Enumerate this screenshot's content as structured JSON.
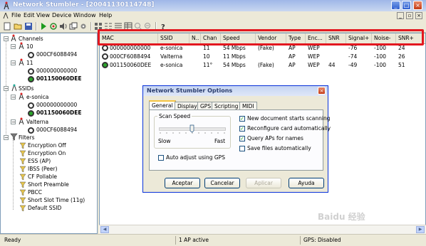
{
  "window": {
    "title": "Network Stumbler - [20041130114748]"
  },
  "menu": [
    "File",
    "Edit",
    "View",
    "Device",
    "Window",
    "Help"
  ],
  "tree": {
    "channels_label": "Channels",
    "ch10_label": "10",
    "ch10_mac": "000CF6088494",
    "ch11_label": "11",
    "ch11_mac1": "000000000000",
    "ch11_mac2": "001150060DEE",
    "ssids_label": "SSIDs",
    "ssid1_label": "e-sonica",
    "ssid1_mac1": "000000000000",
    "ssid1_mac2": "001150060DEE",
    "ssid2_label": "Valterna",
    "ssid2_mac": "000CF6088494",
    "filters_label": "Filters",
    "filters": [
      "Encryption Off",
      "Encryption On",
      "ESS (AP)",
      "IBSS (Peer)",
      "CF Pollable",
      "Short Preamble",
      "PBCC",
      "Short Slot Time (11g)",
      "Default SSID"
    ]
  },
  "table": {
    "columns": [
      "MAC",
      "SSID",
      "N..",
      "Chan",
      "Speed",
      "Vendor",
      "Type",
      "Enc...",
      "SNR",
      "Signal+",
      "Noise-",
      "SNR+"
    ],
    "rows": [
      [
        "000000000000",
        "e-sonica",
        "",
        "11",
        "54 Mbps",
        "(Fake)",
        "AP",
        "WEP",
        "",
        "-76",
        "-100",
        "24"
      ],
      [
        "000CF6088494",
        "Valterna",
        "",
        "10",
        "11 Mbps",
        "",
        "AP",
        "WEP",
        "",
        "-74",
        "-100",
        "26"
      ],
      [
        "001150060DEE",
        "e-sonica",
        "",
        "11°",
        "54 Mbps",
        "(Fake)",
        "AP",
        "WEP",
        "44",
        "-49",
        "-100",
        "51"
      ]
    ]
  },
  "dialog": {
    "title": "Network Stumbler Options",
    "tabs": [
      "General",
      "Display",
      "GPS",
      "Scripting",
      "MIDI"
    ],
    "scan_speed_label": "Scan Speed",
    "slow_label": "Slow",
    "fast_label": "Fast",
    "auto_adjust_label": "Auto adjust using GPS",
    "options": [
      {
        "label": "New document starts scanning",
        "checked": true
      },
      {
        "label": "Reconfigure card automatically",
        "checked": true
      },
      {
        "label": "Query APs for names",
        "checked": true
      },
      {
        "label": "Save files automatically",
        "checked": false
      }
    ],
    "buttons": {
      "ok": "Aceptar",
      "cancel": "Cancelar",
      "apply": "Aplicar",
      "help": "Ayuda"
    }
  },
  "status": {
    "ready": "Ready",
    "ap_active": "1 AP active",
    "gps": "GPS: Disabled"
  },
  "watermark": "Baidu 经验",
  "colors": {
    "highlight_box": "#e3171f",
    "title_bar": "#9fb7e8"
  }
}
